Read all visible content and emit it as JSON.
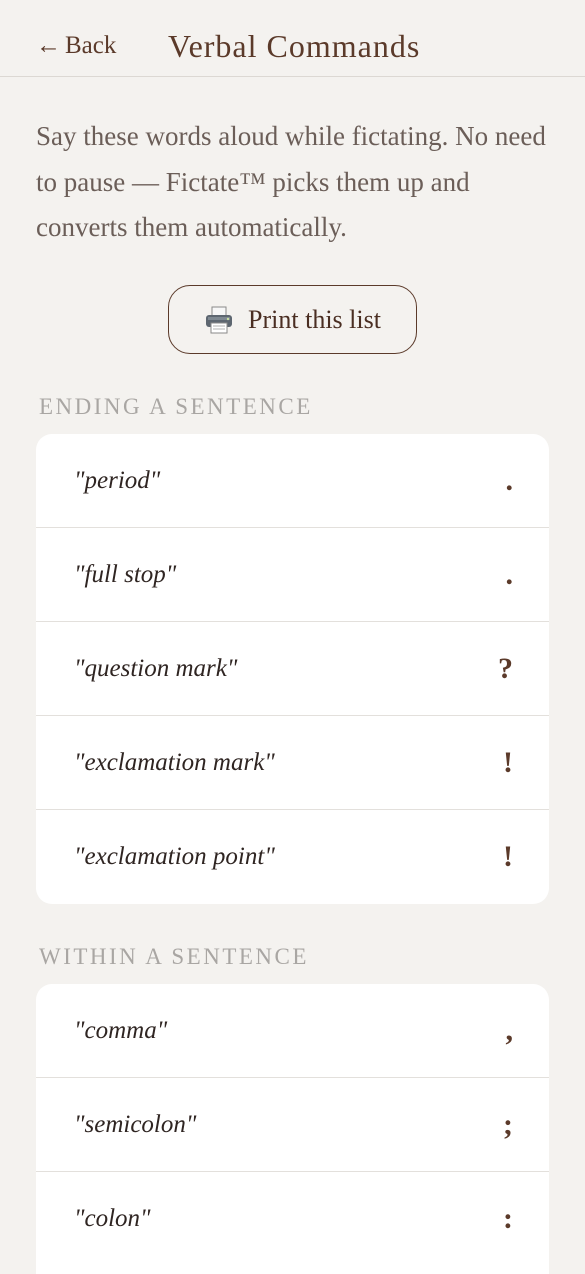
{
  "header": {
    "back_label": "Back",
    "back_arrow": "←",
    "title": "Verbal Commands"
  },
  "intro": "Say these words aloud while fictating. No need to pause — Fictate™ picks them up and converts them automatically.",
  "print_button": {
    "label": "Print this list",
    "icon": "printer-icon"
  },
  "sections": [
    {
      "heading": "ENDING A SENTENCE",
      "items": [
        {
          "phrase": "\"period\"",
          "symbol": "."
        },
        {
          "phrase": "\"full stop\"",
          "symbol": "."
        },
        {
          "phrase": "\"question mark\"",
          "symbol": "?"
        },
        {
          "phrase": "\"exclamation mark\"",
          "symbol": "!"
        },
        {
          "phrase": "\"exclamation point\"",
          "symbol": "!"
        }
      ]
    },
    {
      "heading": "WITHIN A SENTENCE",
      "items": [
        {
          "phrase": "\"comma\"",
          "symbol": ","
        },
        {
          "phrase": "\"semicolon\"",
          "symbol": ";"
        },
        {
          "phrase": "\"colon\"",
          "symbol": ":"
        }
      ]
    }
  ],
  "colors": {
    "background": "#f4f2ef",
    "accent": "#5b3a2a",
    "card": "#ffffff",
    "heading_muted": "#a9a6a3"
  }
}
